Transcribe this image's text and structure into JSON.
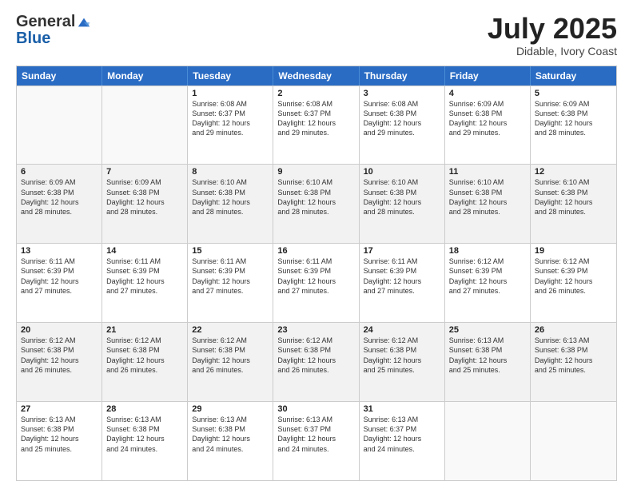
{
  "logo": {
    "general": "General",
    "blue": "Blue"
  },
  "title": "July 2025",
  "subtitle": "Didable, Ivory Coast",
  "header_days": [
    "Sunday",
    "Monday",
    "Tuesday",
    "Wednesday",
    "Thursday",
    "Friday",
    "Saturday"
  ],
  "weeks": [
    [
      {
        "day": "",
        "info": "",
        "empty": true
      },
      {
        "day": "",
        "info": "",
        "empty": true
      },
      {
        "day": "1",
        "info": "Sunrise: 6:08 AM\nSunset: 6:37 PM\nDaylight: 12 hours\nand 29 minutes.",
        "empty": false
      },
      {
        "day": "2",
        "info": "Sunrise: 6:08 AM\nSunset: 6:37 PM\nDaylight: 12 hours\nand 29 minutes.",
        "empty": false
      },
      {
        "day": "3",
        "info": "Sunrise: 6:08 AM\nSunset: 6:38 PM\nDaylight: 12 hours\nand 29 minutes.",
        "empty": false
      },
      {
        "day": "4",
        "info": "Sunrise: 6:09 AM\nSunset: 6:38 PM\nDaylight: 12 hours\nand 29 minutes.",
        "empty": false
      },
      {
        "day": "5",
        "info": "Sunrise: 6:09 AM\nSunset: 6:38 PM\nDaylight: 12 hours\nand 28 minutes.",
        "empty": false
      }
    ],
    [
      {
        "day": "6",
        "info": "Sunrise: 6:09 AM\nSunset: 6:38 PM\nDaylight: 12 hours\nand 28 minutes.",
        "empty": false
      },
      {
        "day": "7",
        "info": "Sunrise: 6:09 AM\nSunset: 6:38 PM\nDaylight: 12 hours\nand 28 minutes.",
        "empty": false
      },
      {
        "day": "8",
        "info": "Sunrise: 6:10 AM\nSunset: 6:38 PM\nDaylight: 12 hours\nand 28 minutes.",
        "empty": false
      },
      {
        "day": "9",
        "info": "Sunrise: 6:10 AM\nSunset: 6:38 PM\nDaylight: 12 hours\nand 28 minutes.",
        "empty": false
      },
      {
        "day": "10",
        "info": "Sunrise: 6:10 AM\nSunset: 6:38 PM\nDaylight: 12 hours\nand 28 minutes.",
        "empty": false
      },
      {
        "day": "11",
        "info": "Sunrise: 6:10 AM\nSunset: 6:38 PM\nDaylight: 12 hours\nand 28 minutes.",
        "empty": false
      },
      {
        "day": "12",
        "info": "Sunrise: 6:10 AM\nSunset: 6:38 PM\nDaylight: 12 hours\nand 28 minutes.",
        "empty": false
      }
    ],
    [
      {
        "day": "13",
        "info": "Sunrise: 6:11 AM\nSunset: 6:39 PM\nDaylight: 12 hours\nand 27 minutes.",
        "empty": false
      },
      {
        "day": "14",
        "info": "Sunrise: 6:11 AM\nSunset: 6:39 PM\nDaylight: 12 hours\nand 27 minutes.",
        "empty": false
      },
      {
        "day": "15",
        "info": "Sunrise: 6:11 AM\nSunset: 6:39 PM\nDaylight: 12 hours\nand 27 minutes.",
        "empty": false
      },
      {
        "day": "16",
        "info": "Sunrise: 6:11 AM\nSunset: 6:39 PM\nDaylight: 12 hours\nand 27 minutes.",
        "empty": false
      },
      {
        "day": "17",
        "info": "Sunrise: 6:11 AM\nSunset: 6:39 PM\nDaylight: 12 hours\nand 27 minutes.",
        "empty": false
      },
      {
        "day": "18",
        "info": "Sunrise: 6:12 AM\nSunset: 6:39 PM\nDaylight: 12 hours\nand 27 minutes.",
        "empty": false
      },
      {
        "day": "19",
        "info": "Sunrise: 6:12 AM\nSunset: 6:39 PM\nDaylight: 12 hours\nand 26 minutes.",
        "empty": false
      }
    ],
    [
      {
        "day": "20",
        "info": "Sunrise: 6:12 AM\nSunset: 6:38 PM\nDaylight: 12 hours\nand 26 minutes.",
        "empty": false
      },
      {
        "day": "21",
        "info": "Sunrise: 6:12 AM\nSunset: 6:38 PM\nDaylight: 12 hours\nand 26 minutes.",
        "empty": false
      },
      {
        "day": "22",
        "info": "Sunrise: 6:12 AM\nSunset: 6:38 PM\nDaylight: 12 hours\nand 26 minutes.",
        "empty": false
      },
      {
        "day": "23",
        "info": "Sunrise: 6:12 AM\nSunset: 6:38 PM\nDaylight: 12 hours\nand 26 minutes.",
        "empty": false
      },
      {
        "day": "24",
        "info": "Sunrise: 6:12 AM\nSunset: 6:38 PM\nDaylight: 12 hours\nand 25 minutes.",
        "empty": false
      },
      {
        "day": "25",
        "info": "Sunrise: 6:13 AM\nSunset: 6:38 PM\nDaylight: 12 hours\nand 25 minutes.",
        "empty": false
      },
      {
        "day": "26",
        "info": "Sunrise: 6:13 AM\nSunset: 6:38 PM\nDaylight: 12 hours\nand 25 minutes.",
        "empty": false
      }
    ],
    [
      {
        "day": "27",
        "info": "Sunrise: 6:13 AM\nSunset: 6:38 PM\nDaylight: 12 hours\nand 25 minutes.",
        "empty": false
      },
      {
        "day": "28",
        "info": "Sunrise: 6:13 AM\nSunset: 6:38 PM\nDaylight: 12 hours\nand 24 minutes.",
        "empty": false
      },
      {
        "day": "29",
        "info": "Sunrise: 6:13 AM\nSunset: 6:38 PM\nDaylight: 12 hours\nand 24 minutes.",
        "empty": false
      },
      {
        "day": "30",
        "info": "Sunrise: 6:13 AM\nSunset: 6:37 PM\nDaylight: 12 hours\nand 24 minutes.",
        "empty": false
      },
      {
        "day": "31",
        "info": "Sunrise: 6:13 AM\nSunset: 6:37 PM\nDaylight: 12 hours\nand 24 minutes.",
        "empty": false
      },
      {
        "day": "",
        "info": "",
        "empty": true
      },
      {
        "day": "",
        "info": "",
        "empty": true
      }
    ]
  ]
}
